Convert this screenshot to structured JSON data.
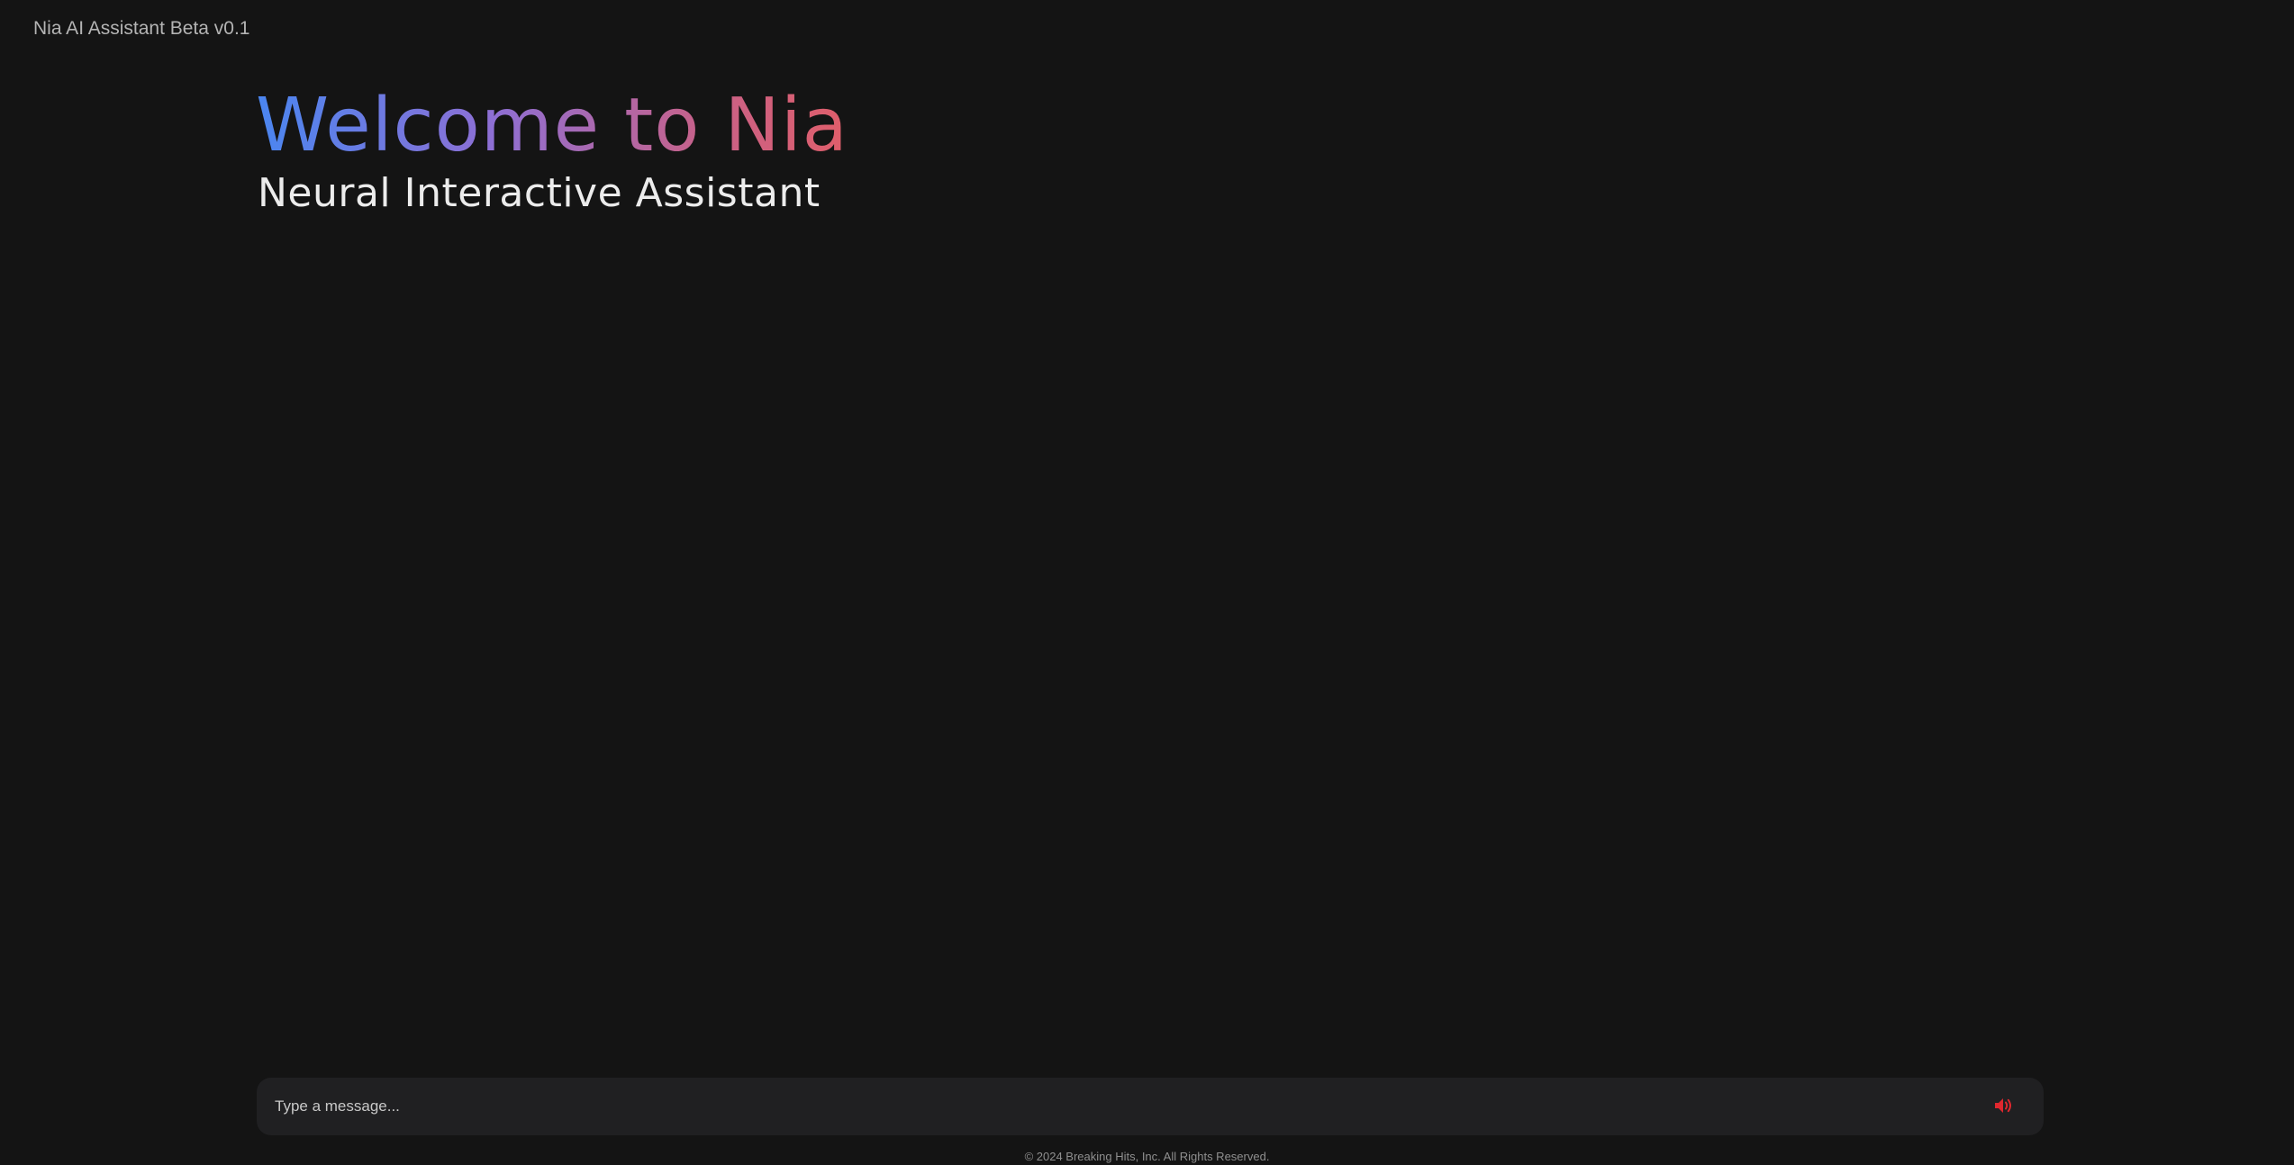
{
  "app": {
    "title": "Nia AI Assistant Beta v0.1"
  },
  "hero": {
    "heading": "Welcome to Nia",
    "subtitle": "Neural Interactive Assistant"
  },
  "composer": {
    "placeholder": "Type a message...",
    "sound_icon": "speaker-volume-icon"
  },
  "footer": {
    "copyright": "© 2024 Breaking Hits, Inc. All Rights Reserved."
  },
  "colors": {
    "background": "#141414",
    "input_background": "#202022",
    "gradient_start": "#4a86f0",
    "gradient_end": "#e05e6a",
    "sound_icon": "#e0272e"
  }
}
